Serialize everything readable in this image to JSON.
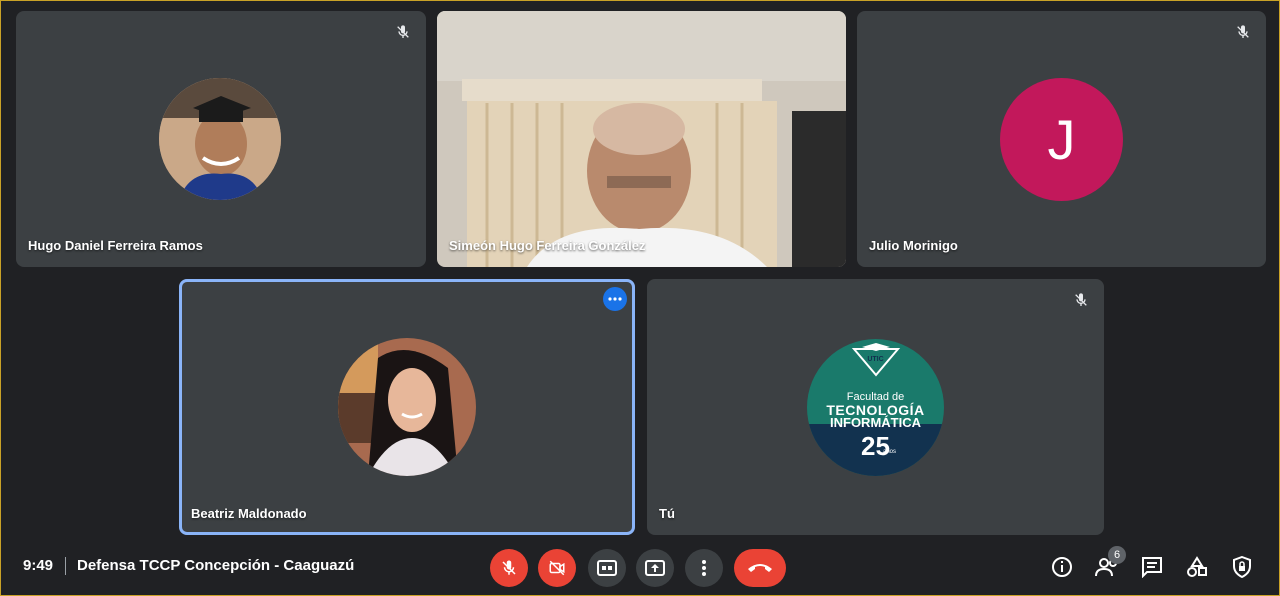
{
  "participants": [
    {
      "name": "Hugo Daniel Ferreira Ramos",
      "muted": true
    },
    {
      "name": "Simeón Hugo Ferreira González",
      "muted": false
    },
    {
      "name": "Julio Morinigo",
      "muted": true,
      "initial": "J",
      "avatar_color": "#c2185b"
    },
    {
      "name": "Beatriz Maldonado",
      "muted": false,
      "active_speaker": true
    },
    {
      "name": "Tú",
      "muted": true,
      "logo": {
        "top": "UTIC",
        "line1": "Facultad de",
        "line2": "TECNOLOGÍA",
        "line3": "INFORMÁTICA",
        "years": "25",
        "years_label": "años"
      }
    }
  ],
  "bottom": {
    "time": "9:49",
    "meeting_title": "Defensa TCCP Concepción - Caaguazú",
    "participants_count": "6"
  },
  "colors": {
    "accent": "#8ab4f8",
    "danger": "#ea4335",
    "tile": "#3c4043",
    "background": "#202124"
  }
}
